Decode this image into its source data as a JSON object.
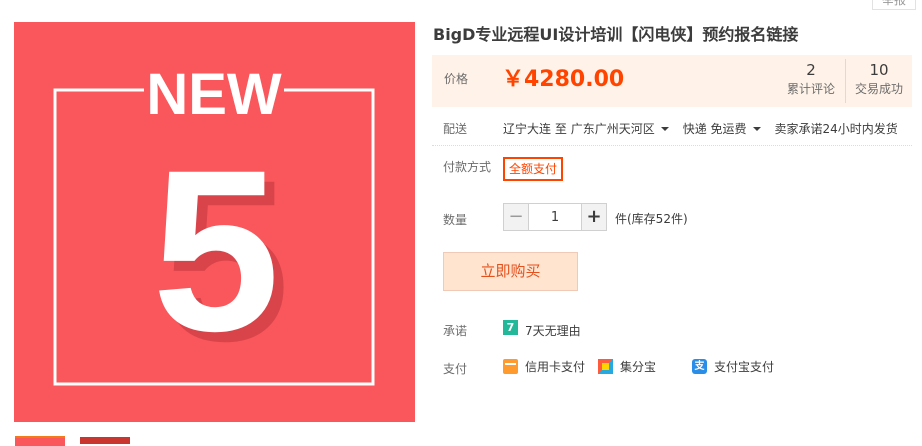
{
  "report_label": "举报",
  "poster": {
    "heading": "NEW",
    "number": "5",
    "colors": {
      "background": "#f9575b",
      "number_shadow": "#d8444a",
      "frame": "#ffffff"
    }
  },
  "product": {
    "title": "BigD专业远程UI设计培训【闪电侠】预约报名链接"
  },
  "price": {
    "label": "价格",
    "value": "￥4280.00",
    "color": "#ff4400"
  },
  "stats": {
    "reviews": {
      "count": "2",
      "label": "累计评论"
    },
    "sales": {
      "count": "10",
      "label": "交易成功"
    }
  },
  "shipping": {
    "label": "配送",
    "from": "辽宁大连",
    "to_word": "至",
    "destination": "广东广州天河区",
    "method": "快递 免运费",
    "promise": "卖家承诺24小时内发货"
  },
  "payment_option": {
    "label": "付款方式",
    "selected": "全额支付"
  },
  "quantity": {
    "label": "数量",
    "minus": "−",
    "plus": "+",
    "value": "1",
    "stock": "件(库存52件)"
  },
  "buy_button": "立即购买",
  "promise": {
    "label": "承诺",
    "icon_text": "7",
    "text": "7天无理由"
  },
  "pay": {
    "label": "支付",
    "methods": [
      {
        "icon": "credit-card-icon",
        "label": "信用卡支付"
      },
      {
        "icon": "jifenbao-icon",
        "label": "集分宝"
      },
      {
        "icon": "alipay-icon",
        "icon_text": "支",
        "label": "支付宝支付"
      }
    ]
  }
}
